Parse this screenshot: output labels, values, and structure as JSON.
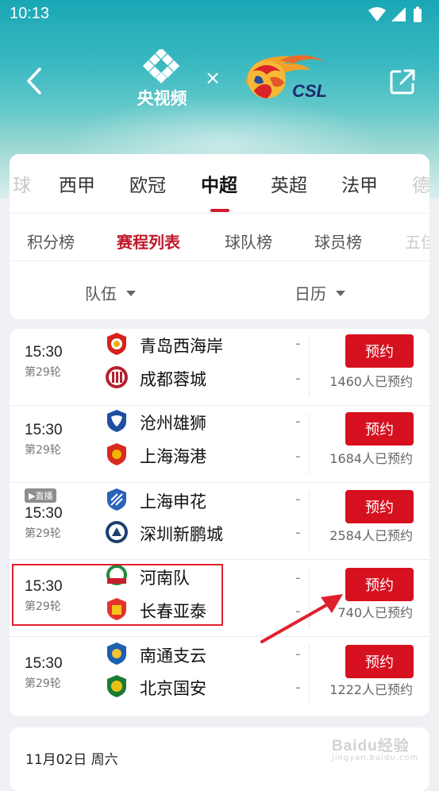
{
  "status_bar": {
    "time": "10:13"
  },
  "header": {
    "brand_name": "央视频",
    "times_symbol": "×",
    "partner_logo_text": "CSL"
  },
  "league_tabs": [
    {
      "label": "球",
      "state": "faded"
    },
    {
      "label": "西甲",
      "state": "normal"
    },
    {
      "label": "欧冠",
      "state": "normal"
    },
    {
      "label": "中超",
      "state": "active"
    },
    {
      "label": "英超",
      "state": "normal"
    },
    {
      "label": "法甲",
      "state": "normal"
    },
    {
      "label": "德",
      "state": "faded"
    }
  ],
  "sub_tabs": [
    {
      "label": "积分榜",
      "state": "normal"
    },
    {
      "label": "赛程列表",
      "state": "active"
    },
    {
      "label": "球队榜",
      "state": "normal"
    },
    {
      "label": "球员榜",
      "state": "normal"
    },
    {
      "label": "五佳",
      "state": "faded"
    }
  ],
  "filters": {
    "team": "队伍",
    "calendar": "日历"
  },
  "matches": [
    {
      "time": "15:30",
      "round": "第29轮",
      "live": false,
      "home": {
        "name": "青岛西海岸",
        "score": "-"
      },
      "away": {
        "name": "成都蓉城",
        "score": "-"
      },
      "button": "预约",
      "count": "1460人已预约"
    },
    {
      "time": "15:30",
      "round": "第29轮",
      "live": false,
      "home": {
        "name": "沧州雄狮",
        "score": "-"
      },
      "away": {
        "name": "上海海港",
        "score": "-"
      },
      "button": "预约",
      "count": "1684人已预约"
    },
    {
      "time": "15:30",
      "round": "第29轮",
      "live": true,
      "live_label": "▶直播",
      "home": {
        "name": "上海申花",
        "score": "-"
      },
      "away": {
        "name": "深圳新鹏城",
        "score": "-"
      },
      "button": "预约",
      "count": "2584人已预约"
    },
    {
      "time": "15:30",
      "round": "第29轮",
      "live": false,
      "home": {
        "name": "河南队",
        "score": "-"
      },
      "away": {
        "name": "长春亚泰",
        "score": "-"
      },
      "button": "预约",
      "count": "740人已预约"
    },
    {
      "time": "15:30",
      "round": "第29轮",
      "live": false,
      "home": {
        "name": "南通支云",
        "score": "-"
      },
      "away": {
        "name": "北京国安",
        "score": "-"
      },
      "button": "预约",
      "count": "1222人已预约"
    }
  ],
  "next_date": "11月02日 周六",
  "watermark": {
    "line1": "Baidu经验",
    "line2": "jingyan.baidu.com"
  },
  "colors": {
    "accent": "#d7101f",
    "hero": "#37b7c0"
  }
}
